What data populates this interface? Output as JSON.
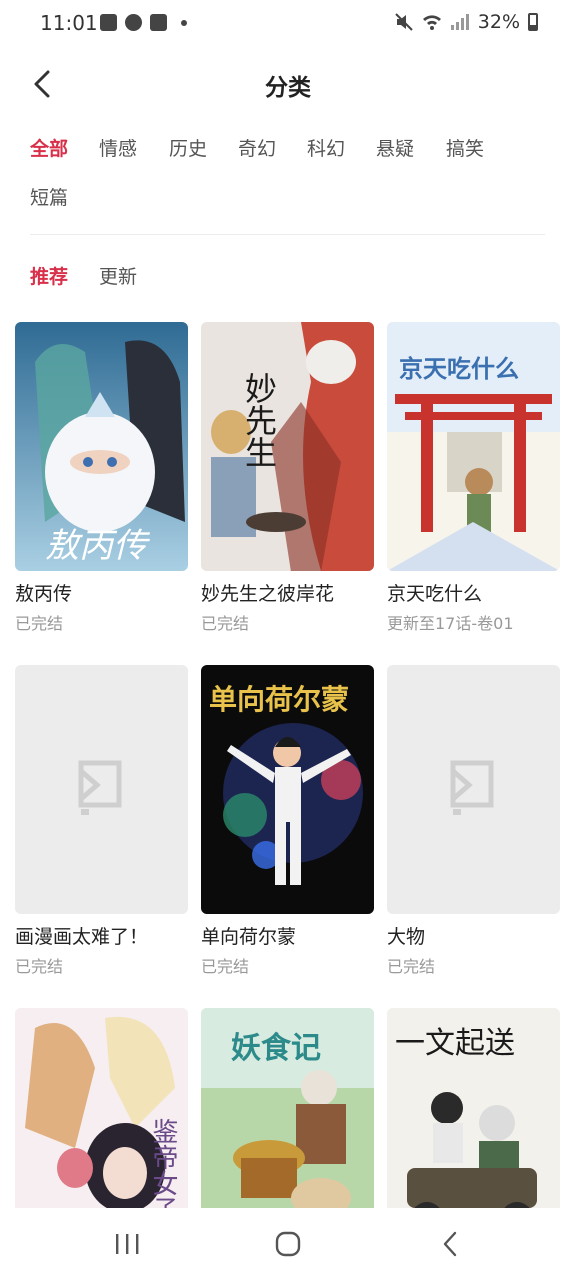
{
  "status_bar": {
    "time": "11:01",
    "battery": "32%"
  },
  "header": {
    "title": "分类"
  },
  "categories": [
    {
      "label": "全部",
      "active": true
    },
    {
      "label": "情感",
      "active": false
    },
    {
      "label": "历史",
      "active": false
    },
    {
      "label": "奇幻",
      "active": false
    },
    {
      "label": "科幻",
      "active": false
    },
    {
      "label": "悬疑",
      "active": false
    },
    {
      "label": "搞笑",
      "active": false
    },
    {
      "label": "短篇",
      "active": false
    }
  ],
  "sort_tabs": [
    {
      "label": "推荐",
      "active": true
    },
    {
      "label": "更新",
      "active": false
    }
  ],
  "comics": [
    {
      "title": "敖丙传",
      "status": "已完结"
    },
    {
      "title": "妙先生之彼岸花",
      "status": "已完结"
    },
    {
      "title": "京天吃什么",
      "status": "更新至17话-卷01"
    },
    {
      "title": "画漫画太难了！",
      "status": "已完结"
    },
    {
      "title": "单向荷尔蒙",
      "status": "已完结"
    },
    {
      "title": "大物",
      "status": "已完结"
    },
    {
      "title": "",
      "status": ""
    },
    {
      "title": "",
      "status": ""
    },
    {
      "title": "",
      "status": ""
    }
  ],
  "cover_art_text": {
    "c0": "敖丙传",
    "c1": "妙先生",
    "c2": "京天吃什么",
    "c4": "单向荷尔蒙",
    "c6": "鉴帝女子图",
    "c7": "妖食记",
    "c8": "一文起送"
  },
  "colors": {
    "accent": "#d8304a"
  }
}
